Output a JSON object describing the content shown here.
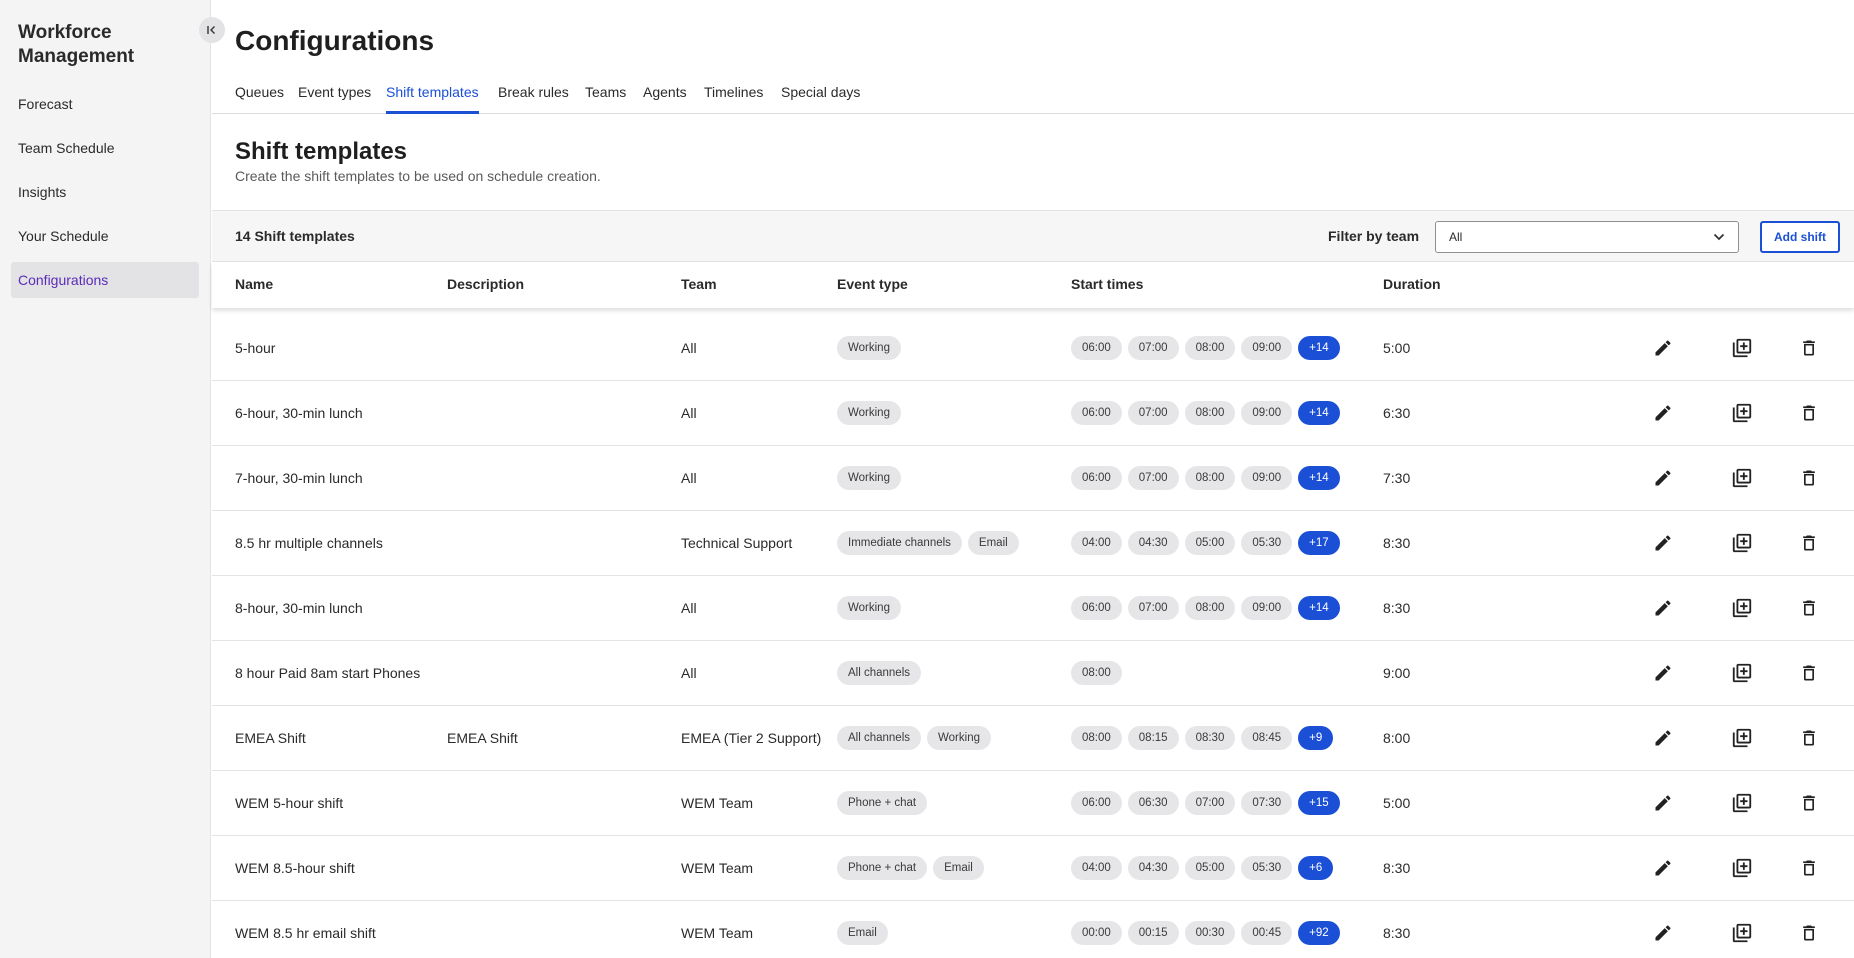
{
  "sidebar": {
    "app_title": "Workforce Management",
    "collapse_icon": "collapse-left-icon",
    "items": [
      {
        "label": "Forecast"
      },
      {
        "label": "Team Schedule"
      },
      {
        "label": "Insights"
      },
      {
        "label": "Your Schedule"
      },
      {
        "label": "Configurations",
        "active": true
      }
    ]
  },
  "header": {
    "title": "Configurations",
    "tabs": [
      {
        "label": "Queues"
      },
      {
        "label": "Event types"
      },
      {
        "label": "Shift templates",
        "active": true
      },
      {
        "label": "Break rules"
      },
      {
        "label": "Teams"
      },
      {
        "label": "Agents"
      },
      {
        "label": "Timelines"
      },
      {
        "label": "Special days"
      }
    ]
  },
  "section": {
    "title": "Shift templates",
    "description": "Create the shift templates to be used on schedule creation."
  },
  "toolbar": {
    "count_label": "14 Shift templates",
    "filter_label": "Filter by team",
    "filter_value": "All",
    "add_label": "Add shift"
  },
  "table": {
    "columns": [
      "Name",
      "Description",
      "Team",
      "Event type",
      "Start times",
      "Duration"
    ],
    "rows": [
      {
        "name": "5-hour",
        "description": "",
        "team": "All",
        "event_types": [
          "Working"
        ],
        "start_times": [
          "06:00",
          "07:00",
          "08:00",
          "09:00"
        ],
        "more": "+14",
        "duration": "5:00"
      },
      {
        "name": "6-hour, 30-min lunch",
        "description": "",
        "team": "All",
        "event_types": [
          "Working"
        ],
        "start_times": [
          "06:00",
          "07:00",
          "08:00",
          "09:00"
        ],
        "more": "+14",
        "duration": "6:30"
      },
      {
        "name": "7-hour, 30-min lunch",
        "description": "",
        "team": "All",
        "event_types": [
          "Working"
        ],
        "start_times": [
          "06:00",
          "07:00",
          "08:00",
          "09:00"
        ],
        "more": "+14",
        "duration": "7:30"
      },
      {
        "name": "8.5 hr multiple channels",
        "description": "",
        "team": "Technical Support",
        "event_types": [
          "Immediate channels",
          "Email"
        ],
        "start_times": [
          "04:00",
          "04:30",
          "05:00",
          "05:30"
        ],
        "more": "+17",
        "duration": "8:30"
      },
      {
        "name": "8-hour, 30-min lunch",
        "description": "",
        "team": "All",
        "event_types": [
          "Working"
        ],
        "start_times": [
          "06:00",
          "07:00",
          "08:00",
          "09:00"
        ],
        "more": "+14",
        "duration": "8:30"
      },
      {
        "name": "8 hour Paid 8am start Phones",
        "description": "",
        "team": "All",
        "event_types": [
          "All channels"
        ],
        "start_times": [
          "08:00"
        ],
        "more": "",
        "duration": "9:00"
      },
      {
        "name": "EMEA Shift",
        "description": "EMEA Shift",
        "team": "EMEA (Tier 2 Support)",
        "event_types": [
          "All channels",
          "Working"
        ],
        "start_times": [
          "08:00",
          "08:15",
          "08:30",
          "08:45"
        ],
        "more": "+9",
        "duration": "8:00"
      },
      {
        "name": "WEM 5-hour shift",
        "description": "",
        "team": "WEM Team",
        "event_types": [
          "Phone + chat"
        ],
        "start_times": [
          "06:00",
          "06:30",
          "07:00",
          "07:30"
        ],
        "more": "+15",
        "duration": "5:00"
      },
      {
        "name": "WEM 8.5-hour shift",
        "description": "",
        "team": "WEM Team",
        "event_types": [
          "Phone + chat",
          "Email"
        ],
        "start_times": [
          "04:00",
          "04:30",
          "05:00",
          "05:30"
        ],
        "more": "+6",
        "duration": "8:30"
      },
      {
        "name": "WEM 8.5 hr email shift",
        "description": "",
        "team": "WEM Team",
        "event_types": [
          "Email"
        ],
        "start_times": [
          "00:00",
          "00:15",
          "00:30",
          "00:45"
        ],
        "more": "+92",
        "duration": "8:30"
      }
    ],
    "row_actions": [
      "edit-icon",
      "duplicate-icon",
      "delete-icon"
    ]
  },
  "colors": {
    "accent": "#1a4fd6",
    "sidebar_active_text": "#5a2bb8",
    "sidebar_bg": "#f4f4f5",
    "chip_bg": "#e6e6e8"
  }
}
